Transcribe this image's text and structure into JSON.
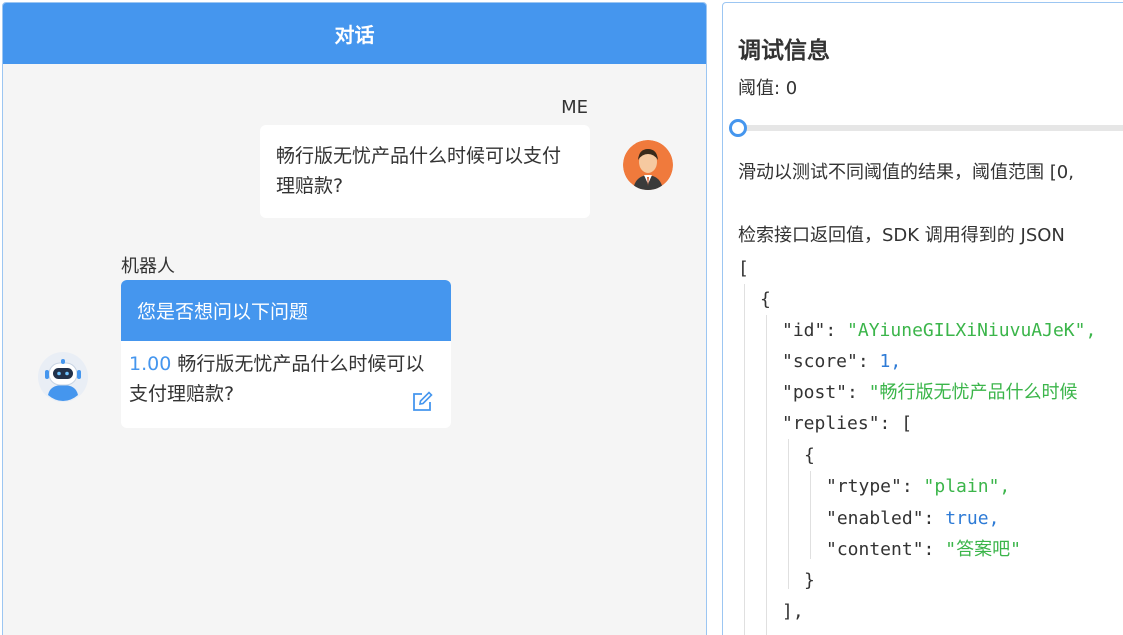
{
  "chat": {
    "title": "对话",
    "me_label": "ME",
    "me_message": "畅行版无忧产品什么时候可以支付理赔款?",
    "bot_label": "机器人",
    "bot_card_title": "您是否想问以下问题",
    "bot_suggestion_score": "1.00",
    "bot_suggestion_text": "畅行版无忧产品什么时候可以支付理赔款?"
  },
  "debug": {
    "title": "调试信息",
    "threshold_label": "阈值: 0",
    "threshold_value": 0,
    "slider_hint": "滑动以测试不同阈值的结果，阈值范围 [0,",
    "api_desc": "检索接口返回值，SDK 调用得到的 JSON",
    "json": {
      "open_bracket": "[",
      "open_brace": "{",
      "id_key": "\"id\"",
      "id_value": "\"AYiuneGILXiNiuvuAJeK\",",
      "score_key": "\"score\"",
      "score_value": "1,",
      "post_key": "\"post\"",
      "post_value": "\"畅行版无忧产品什么时候",
      "replies_key": "\"replies\"",
      "replies_open": "[",
      "reply_open": "{",
      "rtype_key": "\"rtype\"",
      "rtype_value": "\"plain\",",
      "enabled_key": "\"enabled\"",
      "enabled_value": "true,",
      "content_key": "\"content\"",
      "content_value": "\"答案吧\"",
      "reply_close": "}",
      "replies_close": "],"
    },
    "colon": ": "
  },
  "icons": {
    "me_avatar": "man-avatar-icon",
    "bot_avatar": "robot-avatar-icon",
    "edit": "edit-icon"
  },
  "colors": {
    "accent": "#4596ee",
    "json_string": "#3bb54a",
    "json_number": "#2e7bd6"
  }
}
